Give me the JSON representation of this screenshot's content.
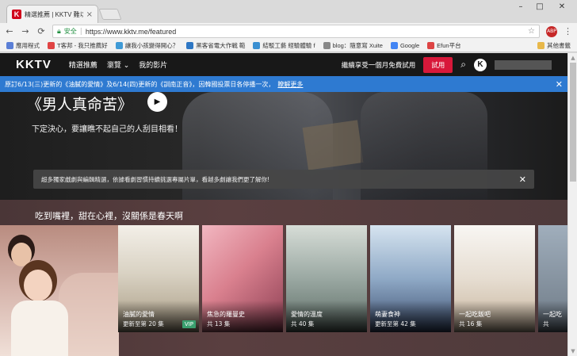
{
  "browser": {
    "tab_title": "精選推薦 | KKTV 難以找到...",
    "tab_favicon": "K",
    "tab_close": "×",
    "window_controls": [
      "–",
      "□",
      "✕"
    ],
    "nav": {
      "back": "←",
      "forward": "→",
      "reload": "⟳"
    },
    "address": {
      "secure_label": "安全",
      "url": "https://www.kktv.me/featured"
    },
    "star": "☆",
    "menu": "⋮",
    "bookmarks": [
      {
        "label": "應用程式",
        "color": "#5b7fd6"
      },
      {
        "label": "T客邦 - 我只推薦好",
        "color": "#e04444"
      },
      {
        "label": "讓我小孩變得開心？",
        "color": "#3f9ad6"
      },
      {
        "label": "黑客省電大作戰 範",
        "color": "#2e77c4"
      },
      {
        "label": "結駁工藝 經驗體驗 f",
        "color": "#3a8fd1"
      },
      {
        "label": "blog：隨意寫 Xuite",
        "color": "#888888"
      },
      {
        "label": "Google",
        "color": "#4285f4"
      },
      {
        "label": "Efun平台",
        "color": "#d44"
      }
    ],
    "bookmarks_right": "其他書籤"
  },
  "kktv": {
    "logo": "KKTV",
    "nav": [
      "精選推薦",
      "瀏覽 ⌄",
      "我的影片"
    ],
    "promo": "繼續享受一個月免費試用",
    "trial_button": "試用",
    "avatar": "K",
    "notice": {
      "text": "原訂6/13(三)更新的《油膩的愛情》及6/14(四)更新的《訓南正音》，因韓國投票日各停播一次，",
      "link": "瞭解更多",
      "close": "✕"
    },
    "hero": {
      "title": "《男人真命苦》",
      "play": "▶",
      "subtitle": "下定決心，要讓瞧不起自己的人刮目相看！",
      "banner": "超多獨家戲劇與編輯精選，依據看劇習慣持續挑選專屬片單，看越多劇讓我們更了解你!",
      "banner_close": "✕"
    },
    "row": {
      "title": "吃到嘴裡，甜在心裡，沒關係是春天啊",
      "cards": [
        {
          "title": "油膩的愛情",
          "episodes": "更新至第 20 集",
          "badge": "VIP"
        },
        {
          "title": "焦急的羅曼史",
          "episodes": "共 13 集"
        },
        {
          "title": "愛情的溫度",
          "episodes": "共 40 集"
        },
        {
          "title": "萌妻食神",
          "episodes": "更新至第 42 集"
        },
        {
          "title": "一起吃飯吧",
          "episodes": "共 16 集"
        },
        {
          "title": "一起吃",
          "episodes": "共"
        }
      ]
    }
  },
  "scrollbar": {
    "up": "▲",
    "down": "▼"
  }
}
